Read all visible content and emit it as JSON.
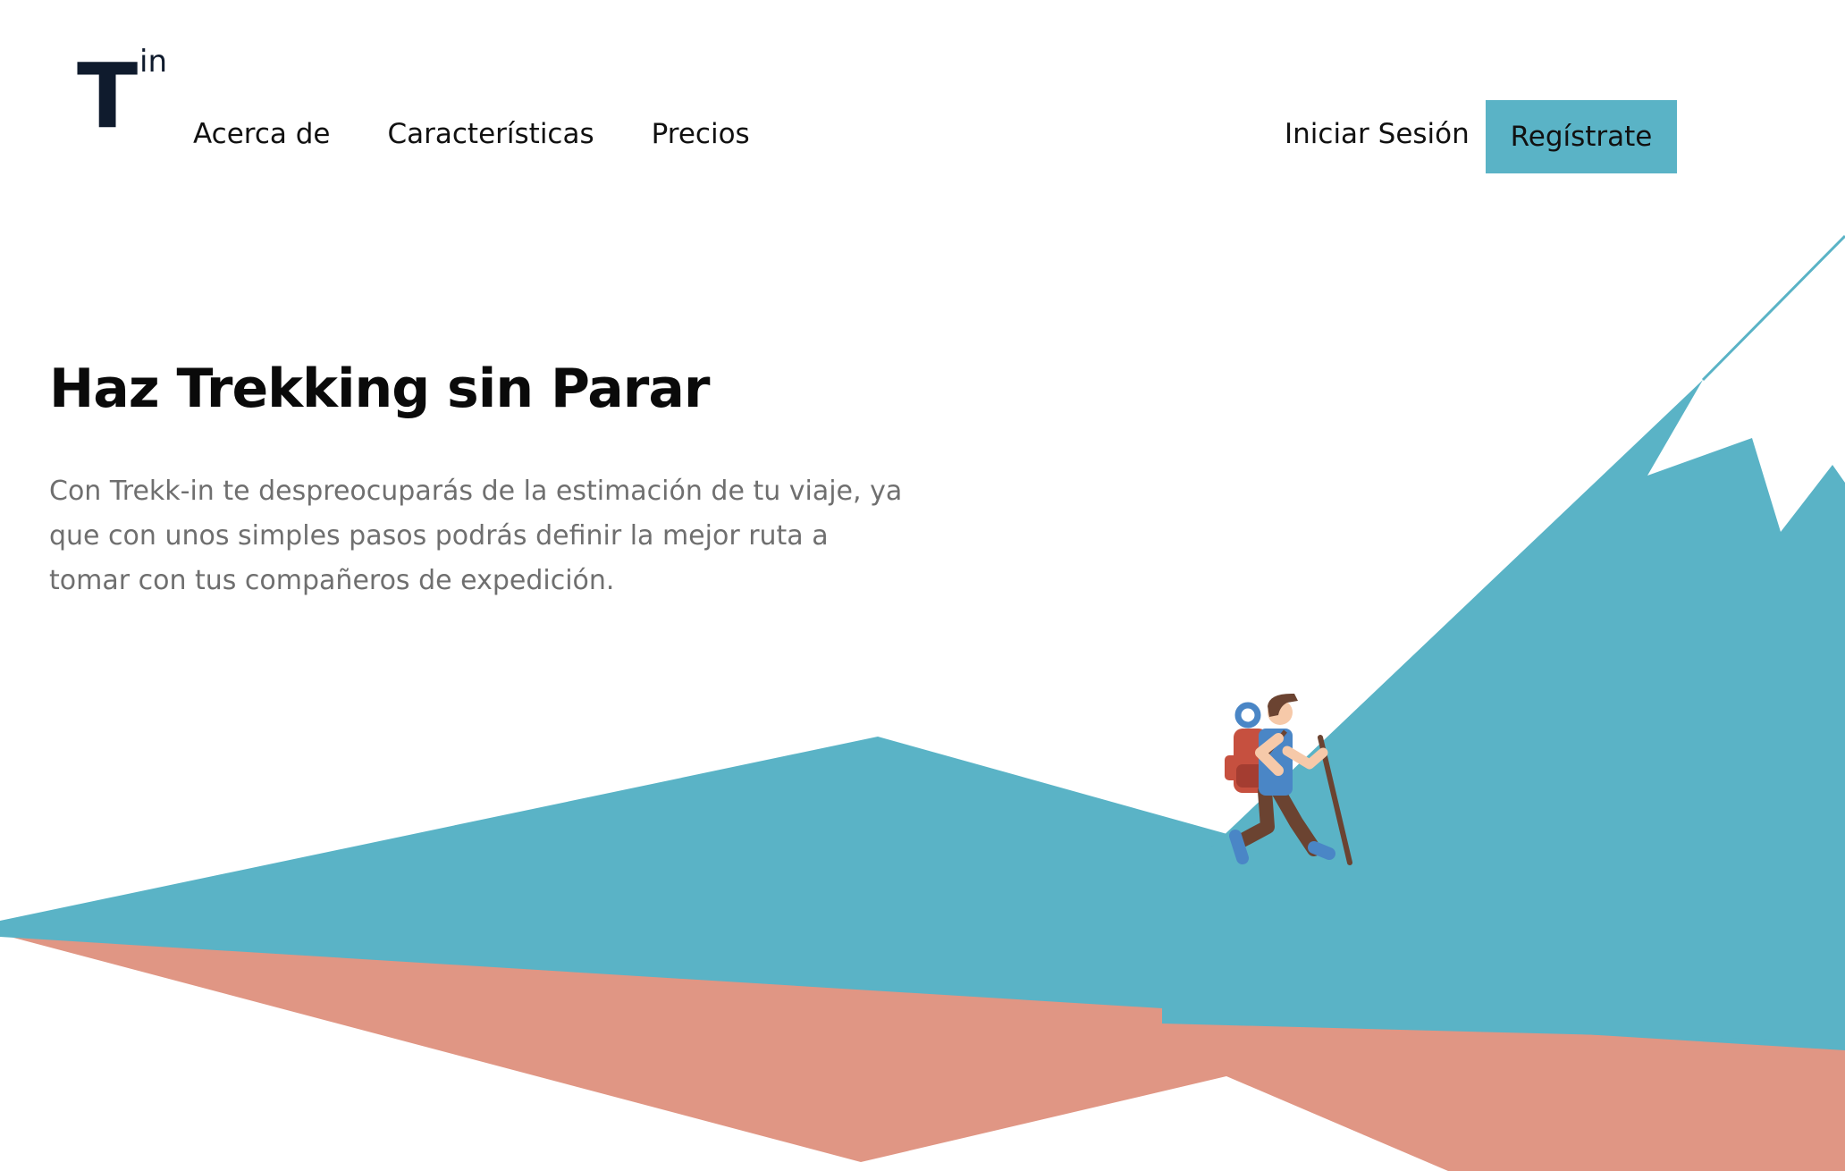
{
  "logo": {
    "letter": "T",
    "superscript": "in"
  },
  "nav": {
    "links": [
      {
        "label": "Acerca de"
      },
      {
        "label": "Características"
      },
      {
        "label": "Precios"
      }
    ],
    "login_label": "Iniciar Sesión",
    "signup_label": "Regístrate"
  },
  "hero": {
    "title": "Haz Trekking sin Parar",
    "description": "Con Trekk-in te despreocuparás de la estimación de tu viaje, ya que con unos simples pasos podrás definir la mejor ruta a tomar con tus compañeros de expedición."
  },
  "colors": {
    "accent": "#5ab3c6",
    "terracotta": "#e09684",
    "logo": "#0f1b2d",
    "body_text": "#6f6f6f"
  },
  "illustration": {
    "subject": "hiker-icon"
  }
}
